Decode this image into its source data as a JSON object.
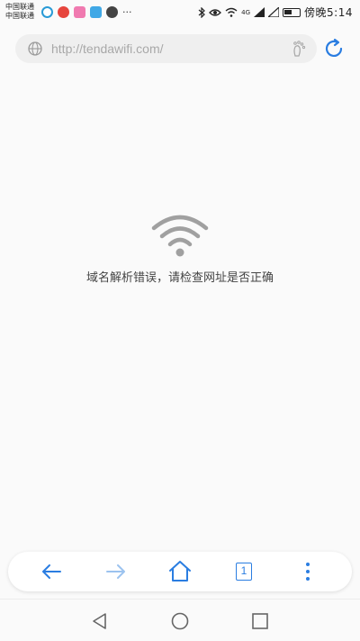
{
  "status_bar": {
    "carrier_1": "中国联通",
    "carrier_2": "中国联通",
    "more": "···",
    "network_label": "4G",
    "time": "傍晚5:14"
  },
  "address_bar": {
    "url_placeholder": "http://tendawifi.com/"
  },
  "error_page": {
    "message": "域名解析错误，请检查网址是否正确"
  },
  "toolbar": {
    "tab_count": "1"
  },
  "colors": {
    "accent": "#2a7de1",
    "disabled": "#9cc3ef",
    "icon_gray": "#a0a0a0"
  }
}
